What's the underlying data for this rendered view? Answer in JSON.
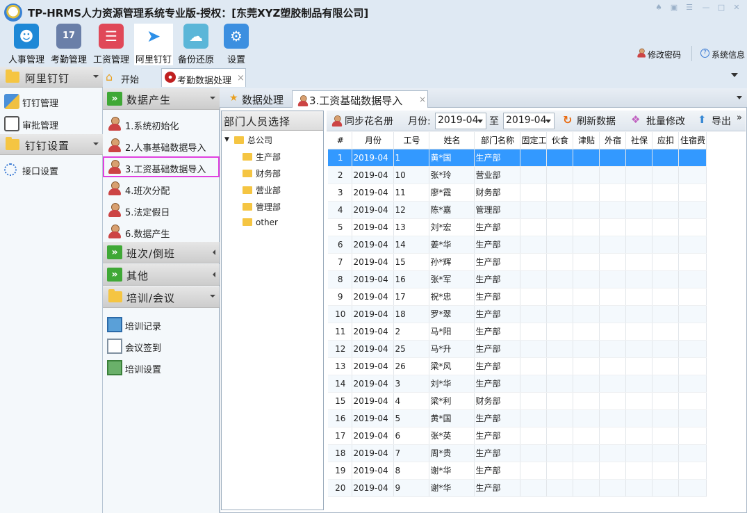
{
  "window": {
    "title": "TP-HRMS人力资源管理系统专业版-授权：[东莞XYZ塑胶制品有限公司]",
    "controls": [
      "♠",
      "▣",
      "☰",
      "—",
      "□",
      "✕"
    ]
  },
  "toolbar": {
    "items": [
      {
        "label": "人事管理",
        "icon": "users-icon",
        "color": "#1e88d6"
      },
      {
        "label": "考勤管理",
        "icon": "calendar-icon",
        "color": "#6a7fa8"
      },
      {
        "label": "工资管理",
        "icon": "payroll-icon",
        "color": "#e04858"
      },
      {
        "label": "阿里钉钉",
        "icon": "dingtalk-icon",
        "color": "#2c8fe8"
      },
      {
        "label": "备份还原",
        "icon": "cloud-icon",
        "color": "#5bb6d8"
      },
      {
        "label": "设置",
        "icon": "gear-icon",
        "color": "#3c8fe0"
      }
    ],
    "change_password": "修改密码",
    "system_info": "系统信息"
  },
  "left_panel": {
    "group1": "阿里钉钉",
    "items1": [
      "钉钉管理",
      "审批管理"
    ],
    "group2": "钉钉设置",
    "items2": [
      "接口设置"
    ]
  },
  "doc_tabs": {
    "start": "开始",
    "attendance": "考勤数据处理",
    "close": "×"
  },
  "mid_panel": {
    "group1": "数据产生",
    "items1": [
      "1.系统初始化",
      "2.人事基础数据导入",
      "3.工资基础数据导入",
      "4.班次分配",
      "5.法定假日",
      "6.数据产生"
    ],
    "group2": "班次/倒班",
    "group3": "其他",
    "group4": "培训/会议",
    "items4": [
      "培训记录",
      "会议签到",
      "培训设置"
    ]
  },
  "inner_tabs": {
    "tab1": "数据处理",
    "tab2": "3.工资基础数据导入",
    "close": "×"
  },
  "dept_panel": {
    "header": "部门人员选择",
    "root": "总公司",
    "children": [
      "生产部",
      "财务部",
      "营业部",
      "管理部",
      "other"
    ]
  },
  "grid_toolbar": {
    "sync": "同步花名册",
    "month_label": "月份:",
    "month_from": "2019-04",
    "to_label": "至",
    "month_to": "2019-04",
    "refresh": "刷新数据",
    "batch_edit": "批量修改",
    "export": "导出"
  },
  "grid": {
    "columns": [
      "#",
      "月份",
      "工号",
      "姓名",
      "部门名称",
      "固定工资",
      "伙食",
      "津贴",
      "外宿",
      "社保",
      "应扣",
      "住宿费"
    ],
    "rows": [
      [
        "1",
        "2019-04",
        "1",
        "黄*国",
        "生产部"
      ],
      [
        "2",
        "2019-04",
        "10",
        "张*玲",
        "营业部"
      ],
      [
        "3",
        "2019-04",
        "11",
        "廖*霞",
        "财务部"
      ],
      [
        "4",
        "2019-04",
        "12",
        "陈*嘉",
        "管理部"
      ],
      [
        "5",
        "2019-04",
        "13",
        "刘*宏",
        "生产部"
      ],
      [
        "6",
        "2019-04",
        "14",
        "姜*华",
        "生产部"
      ],
      [
        "7",
        "2019-04",
        "15",
        "孙*辉",
        "生产部"
      ],
      [
        "8",
        "2019-04",
        "16",
        "张*军",
        "生产部"
      ],
      [
        "9",
        "2019-04",
        "17",
        "祝*忠",
        "生产部"
      ],
      [
        "10",
        "2019-04",
        "18",
        "罗*翠",
        "生产部"
      ],
      [
        "11",
        "2019-04",
        "2",
        "马*阳",
        "生产部"
      ],
      [
        "12",
        "2019-04",
        "25",
        "马*升",
        "生产部"
      ],
      [
        "13",
        "2019-04",
        "26",
        "梁*风",
        "生产部"
      ],
      [
        "14",
        "2019-04",
        "3",
        "刘*华",
        "生产部"
      ],
      [
        "15",
        "2019-04",
        "4",
        "梁*利",
        "财务部"
      ],
      [
        "16",
        "2019-04",
        "5",
        "黄*国",
        "生产部"
      ],
      [
        "17",
        "2019-04",
        "6",
        "张*英",
        "生产部"
      ],
      [
        "18",
        "2019-04",
        "7",
        "周*贵",
        "生产部"
      ],
      [
        "19",
        "2019-04",
        "8",
        "谢*华",
        "生产部"
      ],
      [
        "20",
        "2019-04",
        "9",
        "谢*华",
        "生产部"
      ]
    ]
  },
  "colors": {
    "selected_row": "#3399ff",
    "highlight_border": "#e040e0",
    "accent_green": "#3fa836"
  }
}
